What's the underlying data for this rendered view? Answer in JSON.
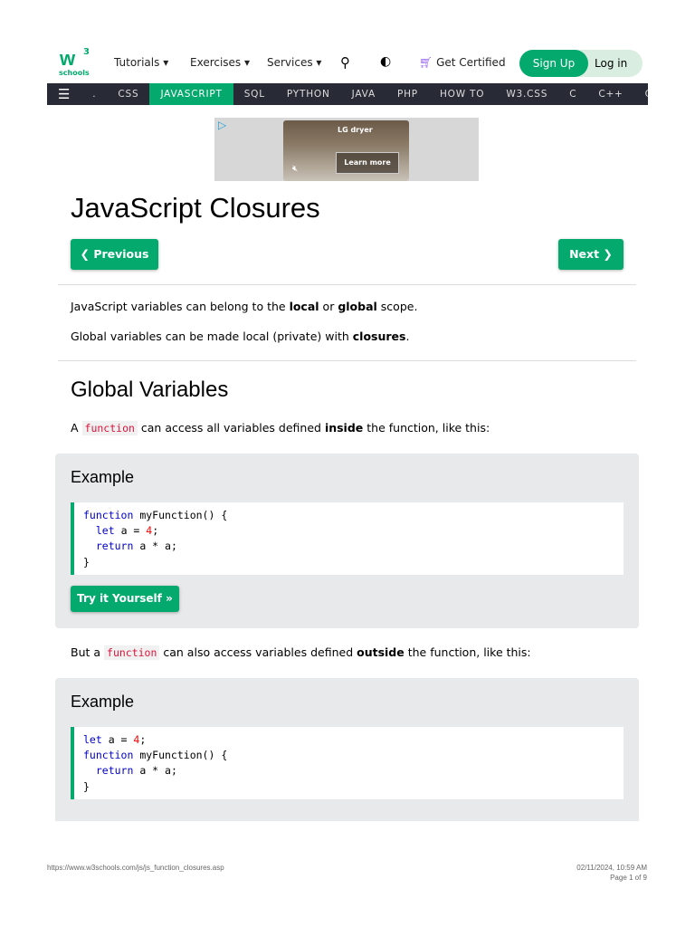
{
  "header": {
    "logo_text": "w3schools",
    "nav": [
      "Tutorials",
      "Exercises",
      "Services"
    ],
    "get_certified": "Get Certified",
    "sign_up": "Sign Up",
    "log_in": "Log in"
  },
  "topbar": {
    "items": [
      ".",
      "CSS",
      "JAVASCRIPT",
      "SQL",
      "PYTHON",
      "JAVA",
      "PHP",
      "HOW TO",
      "W3.CSS",
      "C",
      "C++",
      "C#"
    ],
    "active": "JAVASCRIPT"
  },
  "ad": {
    "brand": "LG dryer",
    "cta": "Learn more"
  },
  "page": {
    "title": "JavaScript Closures",
    "prev": "❮ Previous",
    "next": "Next ❯",
    "intro1": [
      "JavaScript variables can belong to the ",
      "local",
      " or ",
      "global",
      " scope."
    ],
    "intro2": [
      "Global variables can be made local (private) with ",
      "closures",
      "."
    ],
    "h2": "Global Variables",
    "p1": [
      "A ",
      "function",
      " can access all variables defined ",
      "inside",
      " the function, like this:"
    ],
    "example_label": "Example",
    "try_it": "Try it Yourself »",
    "p2": [
      "But a ",
      "function",
      " can also access variables defined ",
      "outside",
      " the function, like this:"
    ]
  },
  "footer": {
    "url": "https://www.w3schools.com/js/js_function_closures.asp",
    "datetime": "02/11/2024, 10:59 AM",
    "page": "Page 1 of 9"
  }
}
